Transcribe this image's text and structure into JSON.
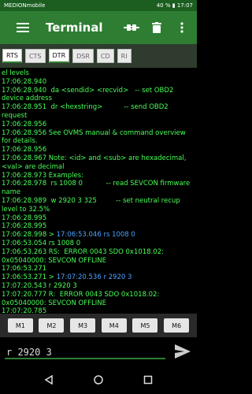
{
  "status": {
    "carrier": "MEDIONmobile",
    "battery": "40 %",
    "time": "17:07"
  },
  "appbar": {
    "title": "Terminal",
    "icons": [
      "menu-icon",
      "connection-icon",
      "delete-icon",
      "more-vert-icon"
    ]
  },
  "toolbar": {
    "buttons": [
      {
        "label": "RTS",
        "active": true
      },
      {
        "label": "CTS",
        "active": false
      },
      {
        "label": "DTR",
        "active": true
      },
      {
        "label": "DSR",
        "active": false
      },
      {
        "label": "CD",
        "active": false
      },
      {
        "label": "RI",
        "active": false
      }
    ]
  },
  "terminal": {
    "lines": [
      {
        "t": "el levels",
        "c": "out"
      },
      {
        "t": "17:06:28.940",
        "c": "out"
      },
      {
        "t": "17:06:28.940  da <sendid> <recvid>   -- set OBD2 device address",
        "c": "out"
      },
      {
        "t": "17:06:28.951  dr <hexstring>          -- send OBD2 request",
        "c": "out"
      },
      {
        "t": "17:06:28.956",
        "c": "out"
      },
      {
        "t": "17:06:28.956 See OVMS manual & command overview for details.",
        "c": "out"
      },
      {
        "t": "17:06:28.956",
        "c": "out"
      },
      {
        "t": "17:06:28.967 Note: <id> and <sub> are hexadecimal, <val> are decimal",
        "c": "out"
      },
      {
        "t": "17:06:28.973 Examples:",
        "c": "out"
      },
      {
        "t": "17:06:28.978  rs 1008 0           -- read SEVCON firmware name",
        "c": "out"
      },
      {
        "t": "17:06:28.989  w 2920 3 325         -- set neutral recup level to 32.5%",
        "c": "out"
      },
      {
        "t": "17:06:28.995",
        "c": "out"
      },
      {
        "t": "17:06:28.995",
        "c": "out"
      },
      {
        "t": "17:06:28.998 > ",
        "c": "out",
        "extra": "17:06:53.046 rs 1008 0",
        "ec": "cmd"
      },
      {
        "t": "17:06:53.054 rs 1008 0",
        "c": "out"
      },
      {
        "t": "17:06:53.263 RS:  ERROR 0043 SDO 0x1018.02: 0x05040000: SEVCON OFFLINE",
        "c": "out"
      },
      {
        "t": "17:06:53.271",
        "c": "out"
      },
      {
        "t": "17:06:53.271 > ",
        "c": "out",
        "extra": "17:07:20.536 r 2920 3",
        "ec": "cmd"
      },
      {
        "t": "17:07:20.543 r 2920 3",
        "c": "out"
      },
      {
        "t": "17:07:20.777 R:  ERROR 0043 SDO 0x1018.02: 0x05040000: SEVCON OFFLINE",
        "c": "out"
      },
      {
        "t": "17:07:20.785",
        "c": "out"
      },
      {
        "t": "17:07:20.785 >",
        "c": "out"
      }
    ]
  },
  "macros": [
    "M1",
    "M2",
    "M3",
    "M4",
    "M5",
    "M6"
  ],
  "input": {
    "value": "r 2920 3"
  },
  "nav": [
    "back-icon",
    "home-icon",
    "recents-icon"
  ],
  "colors": {
    "primary": "#2e7d32",
    "terminal_text": "#48ff56",
    "command_text": "#4da3ff"
  }
}
